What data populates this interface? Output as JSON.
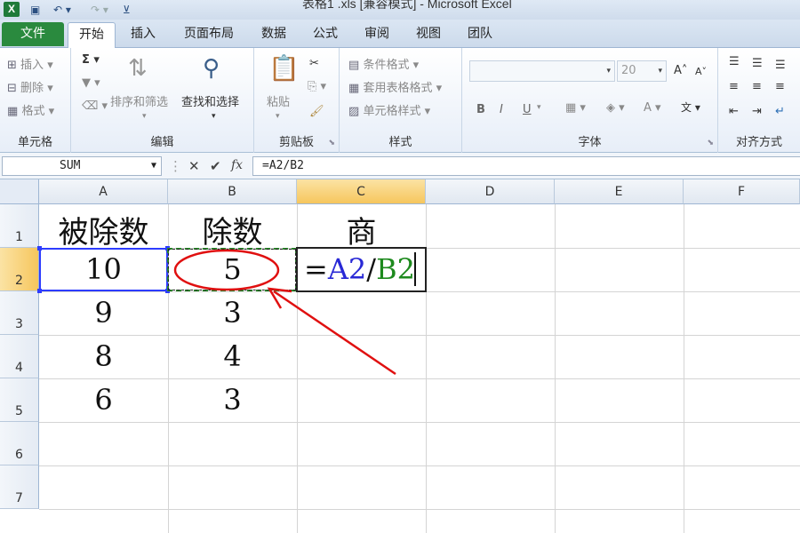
{
  "window": {
    "title": "表格1 .xls  [兼容模式]  - Microsoft Excel",
    "app_icon": "X"
  },
  "quick_access": [
    "save-icon",
    "undo-icon",
    "redo-icon",
    "customize-icon"
  ],
  "tabs": {
    "file": "文件",
    "items": [
      "开始",
      "插入",
      "页面布局",
      "数据",
      "公式",
      "审阅",
      "视图",
      "团队"
    ],
    "active": "开始"
  },
  "ribbon": {
    "cells_group": {
      "label": "单元格",
      "insert": "插入",
      "delete": "删除",
      "format": "格式"
    },
    "editing_group": {
      "label": "编辑",
      "sort_filter": "排序和筛选",
      "find_select": "查找和选择"
    },
    "clipboard_group": {
      "label": "剪贴板",
      "paste": "粘贴"
    },
    "styles_group": {
      "label": "样式",
      "conditional": "条件格式",
      "table_format": "套用表格格式",
      "cell_style": "单元格样式"
    },
    "font_group": {
      "label": "字体",
      "font_name": "",
      "font_size": "20",
      "bold": "B",
      "italic": "I",
      "underline": "U"
    },
    "align_group": {
      "label": "对齐方式"
    }
  },
  "formula_bar": {
    "name_box": "SUM",
    "cancel": "✕",
    "enter": "✔",
    "fx": "fx",
    "formula": "=A2/B2"
  },
  "sheet": {
    "columns": [
      "A",
      "B",
      "C",
      "D",
      "E",
      "F"
    ],
    "rows": [
      "1",
      "2",
      "3",
      "4",
      "5",
      "6",
      "7"
    ],
    "selected_column": "C",
    "selected_row": "2",
    "header_row": [
      "被除数",
      "除数",
      "商"
    ],
    "data": [
      [
        "10",
        "5"
      ],
      [
        "9",
        "3"
      ],
      [
        "8",
        "4"
      ],
      [
        "6",
        "3"
      ]
    ],
    "editing_cell": {
      "eq": "=",
      "ref1": "A2",
      "slash": "/",
      "ref2": "B2"
    }
  },
  "colors": {
    "file_tab": "#2a8a3e",
    "ref1": "#2929d6",
    "ref2": "#1e8a1e",
    "annotation": "#e01010",
    "selection_header": "#f6c65d"
  }
}
